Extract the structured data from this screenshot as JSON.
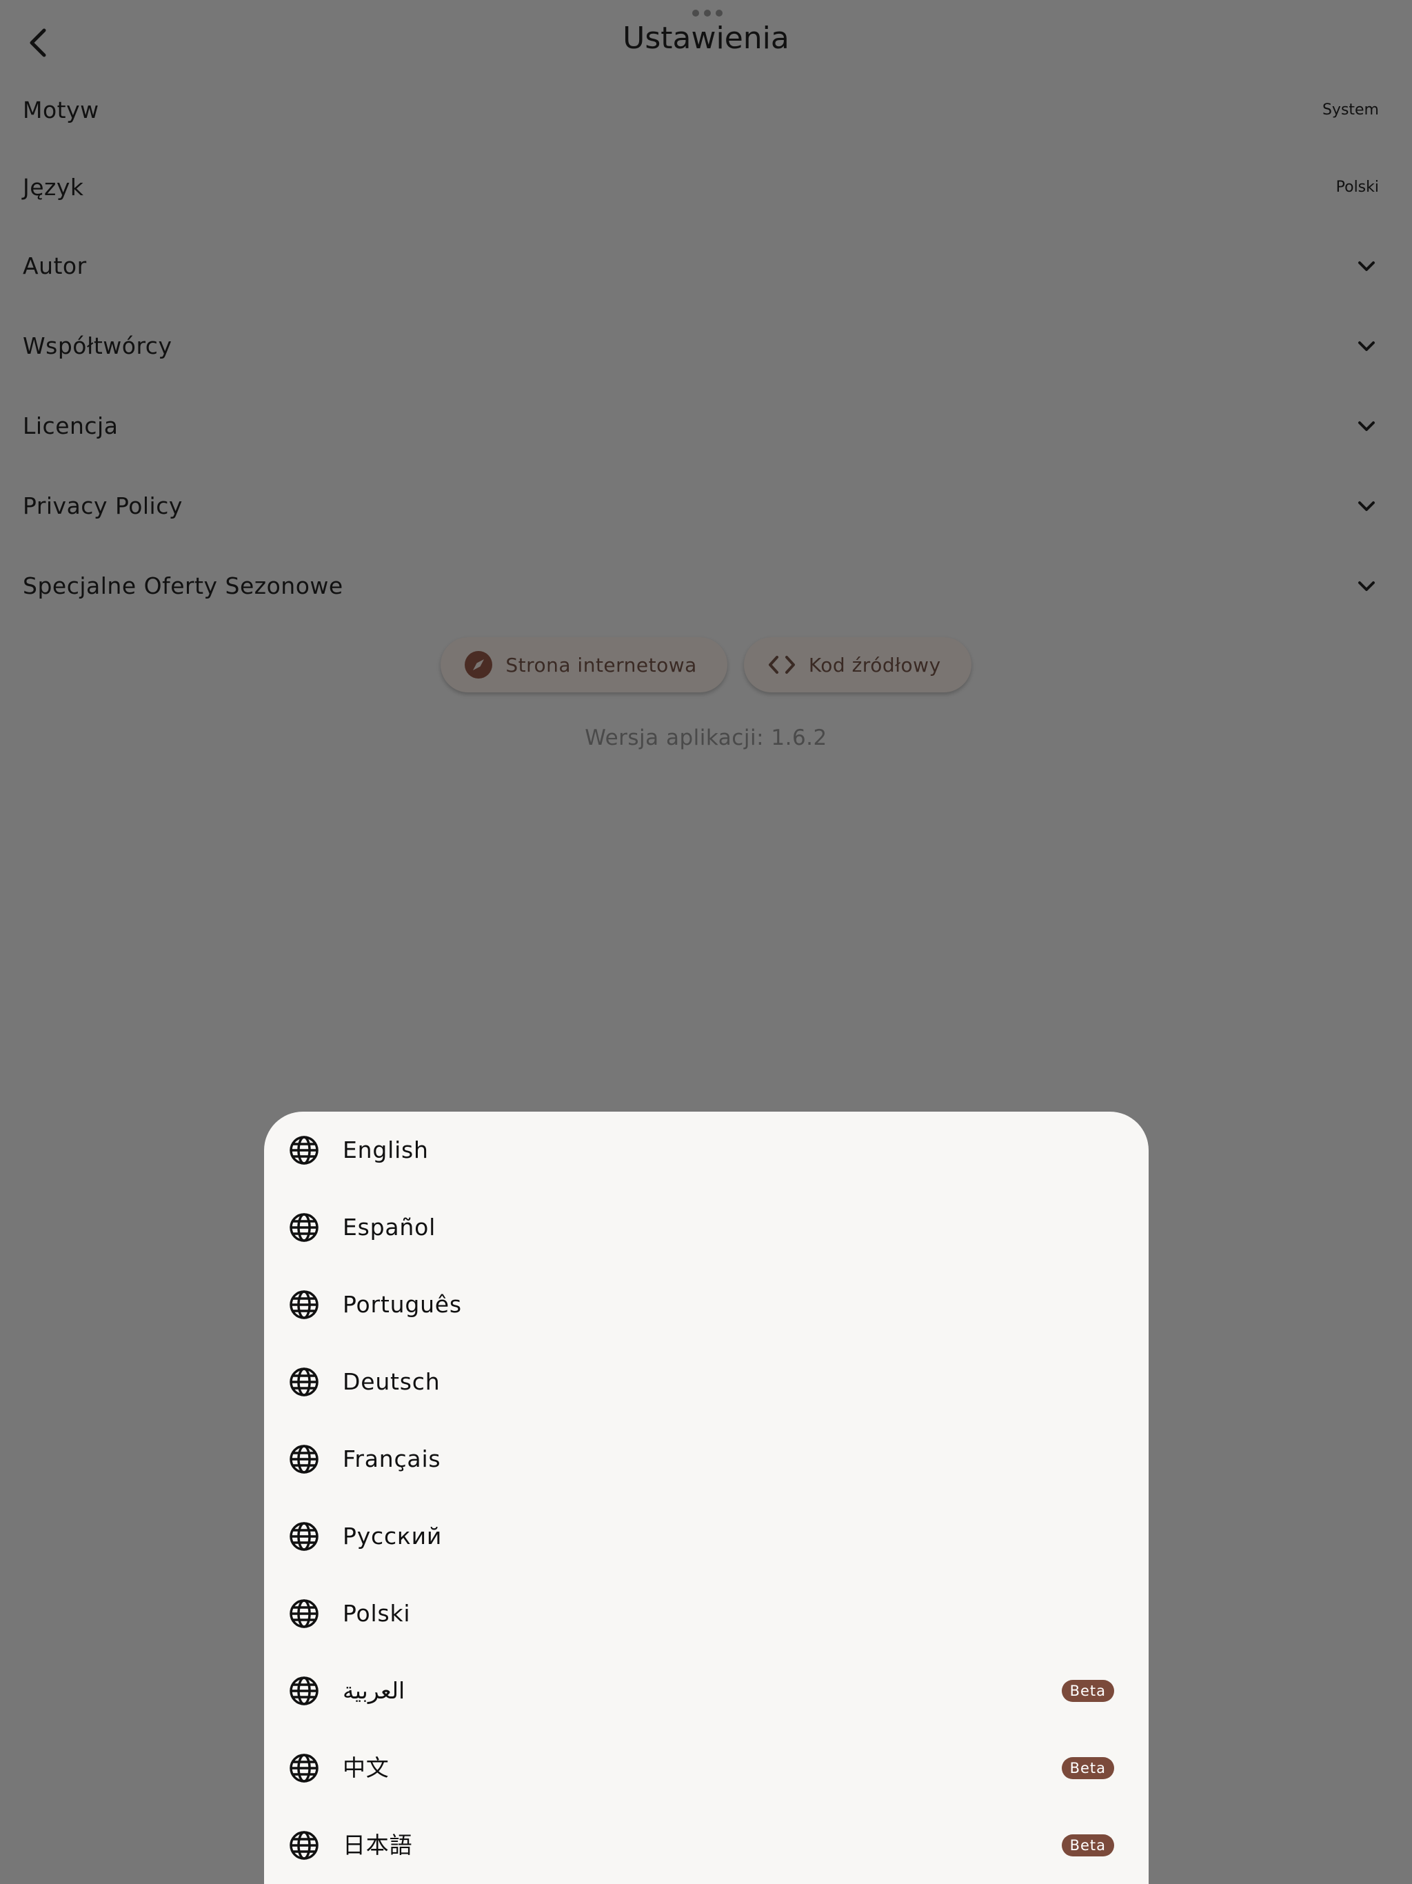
{
  "header": {
    "title": "Ustawienia",
    "back_icon": "chevron-left-icon"
  },
  "settings": {
    "items": [
      {
        "label": "Motyw",
        "value": "System"
      },
      {
        "label": "Język",
        "value": "Polski"
      },
      {
        "label": "Autor"
      },
      {
        "label": "Współtwórcy"
      },
      {
        "label": "Licencja"
      },
      {
        "label": "Privacy Policy"
      },
      {
        "label": "Specjalne Oferty Sezonowe"
      }
    ]
  },
  "links": {
    "website_label": "Strona internetowa",
    "website_icon": "compass-icon",
    "source_label": "Kod źródłowy",
    "source_icon": "code-icon"
  },
  "version_text": "Wersja aplikacji: 1.6.2",
  "language_sheet": {
    "icon": "globe-icon",
    "items": [
      {
        "label": "English"
      },
      {
        "label": "Español"
      },
      {
        "label": "Português"
      },
      {
        "label": "Deutsch"
      },
      {
        "label": "Français"
      },
      {
        "label": "Русский"
      },
      {
        "label": "Polski"
      },
      {
        "label": "العربية",
        "badge": "Beta"
      },
      {
        "label": "中文",
        "badge": "Beta"
      },
      {
        "label": "日本語",
        "badge": "Beta"
      }
    ]
  },
  "colors": {
    "scrim": "#777777",
    "sheet_background": "#f8f7f5",
    "badge_background": "#7b4a3b",
    "accent": "#4a2c24"
  }
}
